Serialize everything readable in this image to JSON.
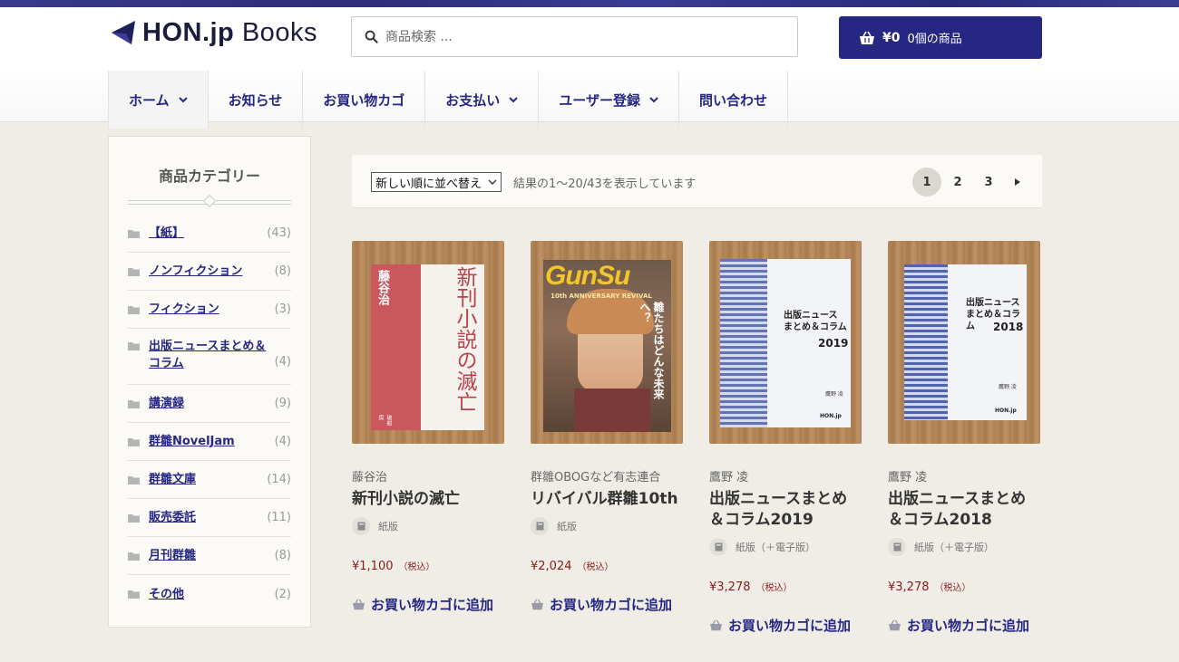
{
  "header": {
    "logo_bold": "HON.jp",
    "logo_light": "Books",
    "search_placeholder": "商品検索 ...",
    "cart_amount": "¥0",
    "cart_count": "0個の商品"
  },
  "nav": [
    {
      "label": "ホーム",
      "dropdown": true
    },
    {
      "label": "お知らせ",
      "dropdown": false
    },
    {
      "label": "お買い物カゴ",
      "dropdown": false
    },
    {
      "label": "お支払い",
      "dropdown": true
    },
    {
      "label": "ユーザー登録",
      "dropdown": true
    },
    {
      "label": "問い合わせ",
      "dropdown": false
    }
  ],
  "sidebar": {
    "title": "商品カテゴリー",
    "categories": [
      {
        "name": "【紙】",
        "count": "(43)"
      },
      {
        "name": "ノンフィクション",
        "count": "(8)"
      },
      {
        "name": "フィクション",
        "count": "(3)"
      },
      {
        "name": "出版ニュースまとめ＆コラム",
        "count": "(4)"
      },
      {
        "name": "講演録",
        "count": "(9)"
      },
      {
        "name": "群雛NovelJam",
        "count": "(4)"
      },
      {
        "name": "群雛文庫",
        "count": "(14)"
      },
      {
        "name": "販売委託",
        "count": "(11)"
      },
      {
        "name": "月刊群雛",
        "count": "(8)"
      },
      {
        "name": "その他",
        "count": "(2)"
      }
    ]
  },
  "toolbar": {
    "sort_selected": "新しい順に並べ替え",
    "result_count": "結果の1〜20/43を表示しています",
    "pages": [
      "1",
      "2",
      "3"
    ],
    "current_page": "1"
  },
  "products": [
    {
      "author": "藤谷治",
      "title": "新刊小説の滅亡",
      "format": "紙版",
      "price": "¥1,100",
      "tax": "（税込）",
      "add_to_cart": "お買い物カゴに追加",
      "cover_text_vertical": "新刊小説の滅亡",
      "cover_author": "藤谷治",
      "cover_publisher": "破船房"
    },
    {
      "author": "群雛OBOGなど有志連合",
      "title": "リバイバル群雛10th",
      "format": "紙版",
      "price": "¥2,024",
      "tax": "（税込）",
      "add_to_cart": "お買い物カゴに追加",
      "cover_logo": "GunSu",
      "cover_subtitle": "10th ANNIVERSARY REVIVAL",
      "cover_tagline": "雛たちはどんな未来へ？"
    },
    {
      "author": "鷹野 凌",
      "title": "出版ニュースまとめ＆コラム2019",
      "format": "紙版（＋電子版）",
      "price": "¥3,278",
      "tax": "（税込）",
      "add_to_cart": "お買い物カゴに追加",
      "cover_title": "出版ニュース まとめ＆コラム",
      "cover_year": "2019",
      "cover_author": "鷹野 凌",
      "cover_publisher": "HON.jp"
    },
    {
      "author": "鷹野 凌",
      "title": "出版ニュースまとめ＆コラム2018",
      "format": "紙版（＋電子版）",
      "price": "¥3,278",
      "tax": "（税込）",
      "add_to_cart": "お買い物カゴに追加",
      "cover_title": "出版ニュース まとめ＆コラム",
      "cover_year": "2018",
      "cover_author": "鷹野 凌",
      "cover_publisher": "HON.jp"
    }
  ],
  "colors": {
    "brand": "#262683",
    "price": "#8b1a1a"
  }
}
